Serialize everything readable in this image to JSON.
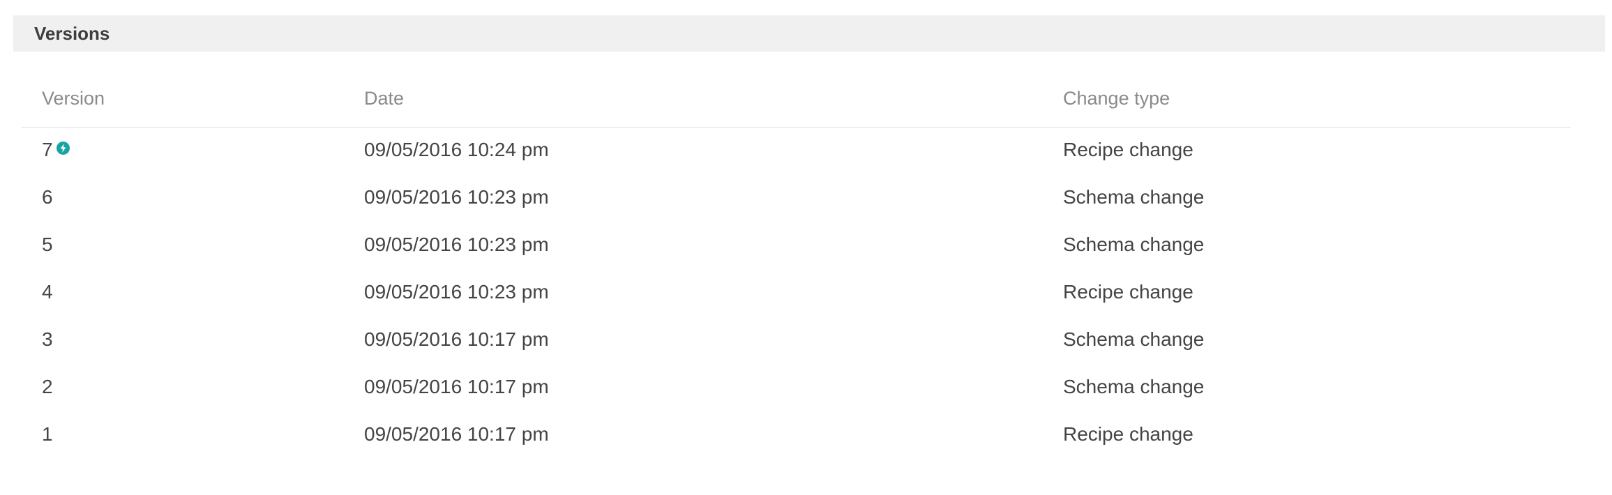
{
  "section": {
    "title": "Versions"
  },
  "table": {
    "columns": [
      "Version",
      "Date",
      "Change type"
    ],
    "rows": [
      {
        "version": "7",
        "date": "09/05/2016 10:24 pm",
        "change_type": "Recipe change",
        "current": true
      },
      {
        "version": "6",
        "date": "09/05/2016 10:23 pm",
        "change_type": "Schema change",
        "current": false
      },
      {
        "version": "5",
        "date": "09/05/2016 10:23 pm",
        "change_type": "Schema change",
        "current": false
      },
      {
        "version": "4",
        "date": "09/05/2016 10:23 pm",
        "change_type": "Recipe change",
        "current": false
      },
      {
        "version": "3",
        "date": "09/05/2016 10:17 pm",
        "change_type": "Schema change",
        "current": false
      },
      {
        "version": "2",
        "date": "09/05/2016 10:17 pm",
        "change_type": "Schema change",
        "current": false
      },
      {
        "version": "1",
        "date": "09/05/2016 10:17 pm",
        "change_type": "Recipe change",
        "current": false
      }
    ]
  },
  "icons": {
    "current_version": "lightning-bolt-icon"
  },
  "colors": {
    "header_bg": "#f0f0f0",
    "accent": "#1aa3a3",
    "column_header_text": "#8a8a8a",
    "body_text": "#444444"
  }
}
